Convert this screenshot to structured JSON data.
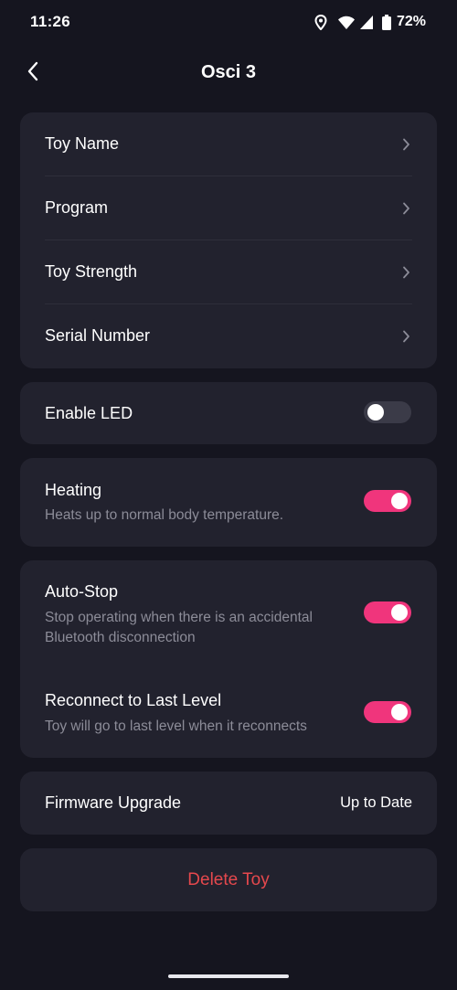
{
  "status_bar": {
    "time": "11:26",
    "battery": "72%",
    "icons": [
      "location-icon",
      "wifi-icon",
      "signal-icon",
      "battery-icon"
    ]
  },
  "header": {
    "title": "Osci 3",
    "back_icon": "chevron-left-icon"
  },
  "toy_settings": {
    "items": [
      {
        "label": "Toy Name"
      },
      {
        "label": "Program"
      },
      {
        "label": "Toy Strength"
      },
      {
        "label": "Serial Number"
      }
    ]
  },
  "led": {
    "label": "Enable LED",
    "enabled": false
  },
  "heating": {
    "label": "Heating",
    "description": "Heats up to normal body temperature.",
    "enabled": true
  },
  "auto_stop": {
    "label": "Auto-Stop",
    "description": "Stop operating when there is an accidental Bluetooth disconnection",
    "enabled": true
  },
  "reconnect": {
    "label": "Reconnect to Last Level",
    "description": "Toy will go to last level when it reconnects",
    "enabled": true
  },
  "firmware": {
    "label": "Firmware Upgrade",
    "status": "Up to Date"
  },
  "delete": {
    "label": "Delete Toy"
  },
  "colors": {
    "background": "#15151f",
    "card": "#22222e",
    "accent": "#f0357c",
    "danger": "#e5484d",
    "secondary_text": "#8c8c98"
  }
}
